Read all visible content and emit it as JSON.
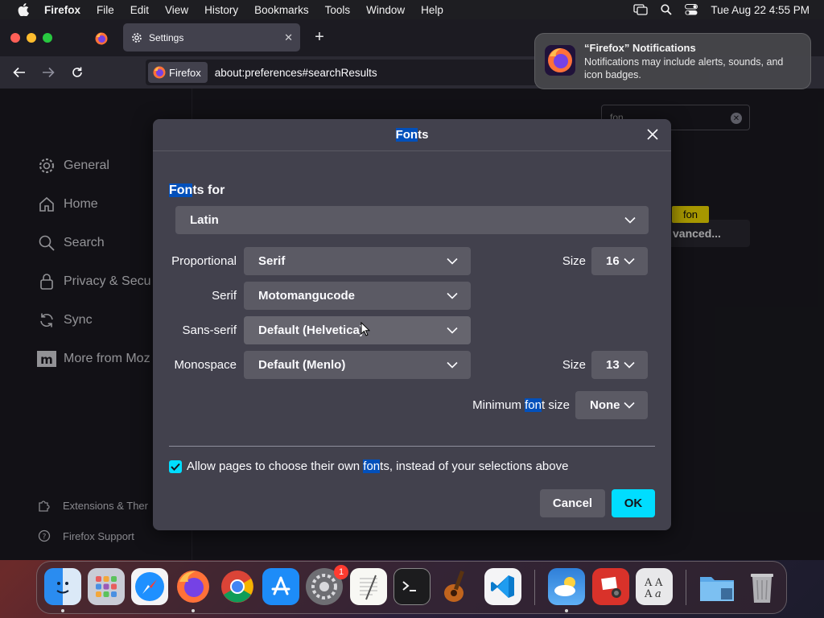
{
  "menubar": {
    "app_name": "Firefox",
    "items": [
      "File",
      "Edit",
      "View",
      "History",
      "Bookmarks",
      "Tools",
      "Window",
      "Help"
    ],
    "datetime": "Tue Aug 22  4:55 PM"
  },
  "browser": {
    "tab_title": "Settings",
    "identity_label": "Firefox",
    "url": "about:preferences#searchResults"
  },
  "prefs": {
    "sidebar": [
      "General",
      "Home",
      "Search",
      "Privacy & Secu",
      "Sync",
      "More from Moz"
    ],
    "footer": [
      "Extensions & Ther",
      "Firefox Support"
    ],
    "search_value": "fon",
    "tooltip": "fon",
    "advanced_button": "vanced..."
  },
  "notification": {
    "title": "“Firefox” Notifications",
    "body": "Notifications may include alerts, sounds, and icon badges."
  },
  "dialog": {
    "title_hl": "Fon",
    "title_rest": "ts",
    "fonts_for_hl": "Fon",
    "fonts_for_rest": "ts for",
    "language": "Latin",
    "proportional_label": "Proportional",
    "proportional_value": "Serif",
    "size_label": "Size",
    "proportional_size": "16",
    "serif_label": "Serif",
    "serif_value": "Motomangucode",
    "sans_label": "Sans-serif",
    "sans_value": "Default (Helvetica)",
    "mono_label": "Monospace",
    "mono_value": "Default (Menlo)",
    "mono_size": "13",
    "min_size_pre": "Minimum ",
    "min_size_hl": "fon",
    "min_size_post": "t size",
    "min_size_value": "None",
    "allow_pre": "Allow pages to choose their own ",
    "allow_hl": "fon",
    "allow_post": "ts, instead of your selections above",
    "allow_checked": true,
    "cancel": "Cancel",
    "ok": "OK"
  },
  "dock": {
    "apps": [
      "Finder",
      "Launchpad",
      "Safari",
      "Firefox",
      "Chrome",
      "App Store",
      "System Settings",
      "TextEdit",
      "Terminal",
      "GarageBand",
      "VS Code",
      "Weather",
      "Photo Booth",
      "Font Book",
      "Downloads",
      "Trash"
    ],
    "settings_badge": "1"
  },
  "colors": {
    "accent": "#00ddff",
    "highlight": "#0250bb",
    "dialog_bg": "#42414d",
    "select_bg": "#5b5a64",
    "page_bg": "#1c1b22"
  }
}
